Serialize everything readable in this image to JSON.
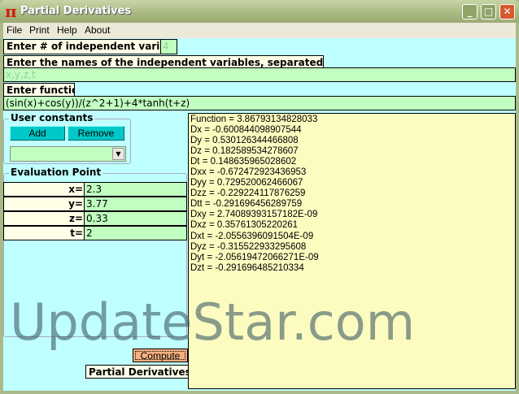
{
  "window": {
    "title": "Partial Derivatives",
    "icon": "pi-icon",
    "controls": {
      "minimize": "_",
      "maximize": "□",
      "close": "✕"
    }
  },
  "menu": [
    "File",
    "Print",
    "Help",
    "About"
  ],
  "num_vars": {
    "label": "Enter # of independent variables:",
    "value": "4"
  },
  "var_names": {
    "label": "Enter the names of the independent variables, separated by commas:",
    "value": "x,y,z,t"
  },
  "function": {
    "label": "Enter function:",
    "value": "(sin(x)+cos(y))/(z^2+1)+4*tanh(t+z)"
  },
  "user_constants": {
    "title": "User constants",
    "add": "Add",
    "remove": "Remove",
    "selected": ""
  },
  "evaluation_point": {
    "title": "Evaluation Point",
    "vars": [
      {
        "label": "x=",
        "value": "2.3"
      },
      {
        "label": "y=",
        "value": "3.77"
      },
      {
        "label": "z=",
        "value": "0.33"
      },
      {
        "label": "t=",
        "value": "2"
      }
    ]
  },
  "compute": "Compute",
  "result_label": "Partial Derivatives:",
  "results": [
    "Function = 3.86793134828033",
    "Dx = -0.600844098907544",
    "Dy = 0.530126344466808",
    "Dz = 0.182589534278607",
    "Dt = 0.148635965028602",
    "Dxx = -0.672472923436953",
    "Dyy = 0.729520062466067",
    "Dzz = -0.229224117876259",
    "Dtt = -0.291696456289759",
    "Dxy = 2.74089393157182E-09",
    "Dxz = 0.35761305220261",
    "Dxt = -2.0556396091504E-09",
    "Dyz = -0.315522933295608",
    "Dyt = -2.05619472066271E-09",
    "Dzt = -0.291696485210334"
  ],
  "watermark": "UpdateStar.com"
}
